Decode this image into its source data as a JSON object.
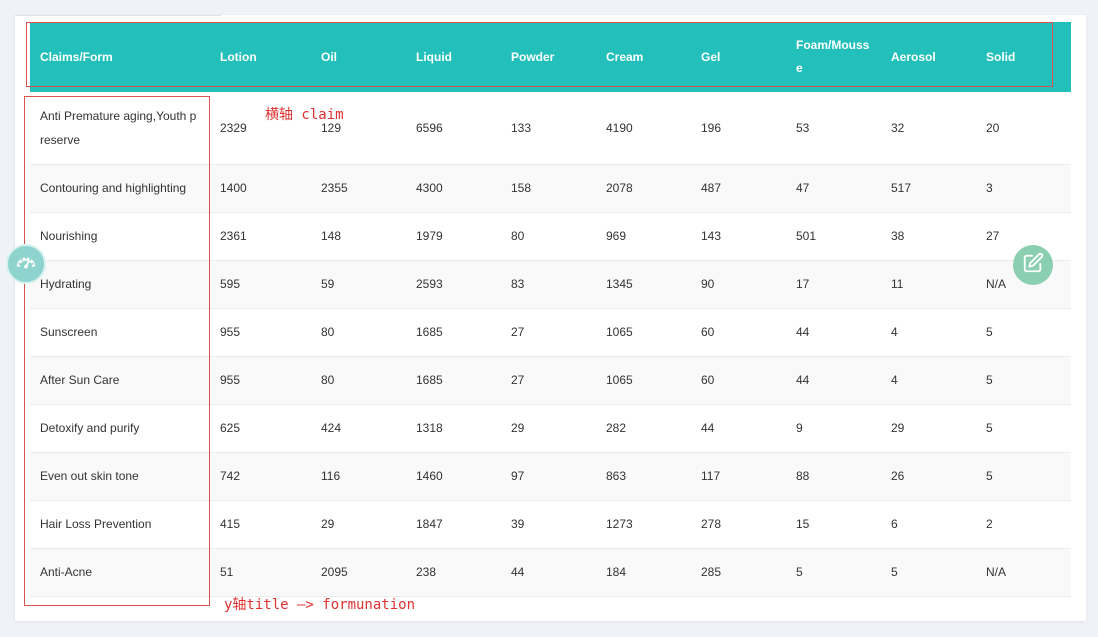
{
  "table": {
    "headers": [
      "Claims/Form",
      "Lotion",
      "Oil",
      "Liquid",
      "Powder",
      "Cream",
      "Gel",
      "Foam/Mousse",
      "Aerosol",
      "Solid"
    ],
    "rows": [
      [
        "Anti Premature aging,Youth preserve",
        "2329",
        "129",
        "6596",
        "133",
        "4190",
        "196",
        "53",
        "32",
        "20"
      ],
      [
        "Contouring and highlighting",
        "1400",
        "2355",
        "4300",
        "158",
        "2078",
        "487",
        "47",
        "517",
        "3"
      ],
      [
        "Nourishing",
        "2361",
        "148",
        "1979",
        "80",
        "969",
        "143",
        "501",
        "38",
        "27"
      ],
      [
        "Hydrating",
        "595",
        "59",
        "2593",
        "83",
        "1345",
        "90",
        "17",
        "11",
        "N/A"
      ],
      [
        "Sunscreen",
        "955",
        "80",
        "1685",
        "27",
        "1065",
        "60",
        "44",
        "4",
        "5"
      ],
      [
        "After Sun Care",
        "955",
        "80",
        "1685",
        "27",
        "1065",
        "60",
        "44",
        "4",
        "5"
      ],
      [
        "Detoxify and purify",
        "625",
        "424",
        "1318",
        "29",
        "282",
        "44",
        "9",
        "29",
        "5"
      ],
      [
        "Even out skin tone",
        "742",
        "116",
        "1460",
        "97",
        "863",
        "117",
        "88",
        "26",
        "5"
      ],
      [
        "Hair Loss Prevention",
        "415",
        "29",
        "1847",
        "39",
        "1273",
        "278",
        "15",
        "6",
        "2"
      ],
      [
        "Anti-Acne",
        "51",
        "2095",
        "238",
        "44",
        "184",
        "285",
        "5",
        "5",
        "N/A"
      ]
    ]
  },
  "annotations": {
    "header_note": "横轴 claim",
    "column_note": "y轴title —> formunation"
  },
  "fabs": {
    "left_icon": "dashboard-gauge-icon",
    "right_icon": "edit-icon"
  },
  "colors": {
    "header_bg": "#22bfbb",
    "annotation": "#e03030",
    "fab_left": "#8fd3cf",
    "fab_right": "#8bcfb0"
  }
}
